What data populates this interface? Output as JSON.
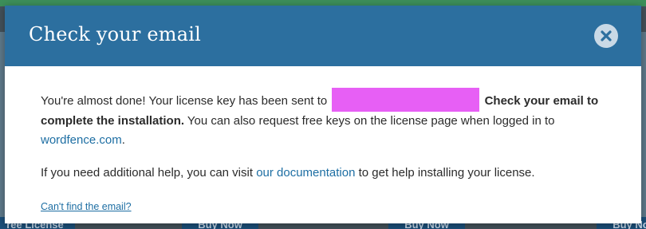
{
  "modal": {
    "title": "Check your email",
    "close_icon": "close-icon",
    "body": {
      "text_1": "You're almost done! Your license key has been sent to",
      "text_bold": "Check your email to complete the installation.",
      "text_2": " You can also request free keys on the license page when logged in to ",
      "link_wordfence": "wordfence.com",
      "text_3": ".",
      "help_1": "If you need additional help, you can visit ",
      "link_docs": "our documentation",
      "help_2": " to get help installing your license.",
      "cant_find": "Can't find the email?"
    }
  },
  "background": {
    "buttons": [
      "ree License",
      "Buy Now",
      "Buy Now",
      "Buy Now"
    ]
  },
  "colors": {
    "header": "#2c6f9f",
    "link": "#1d6ea3",
    "redaction": "#e75ff5"
  }
}
